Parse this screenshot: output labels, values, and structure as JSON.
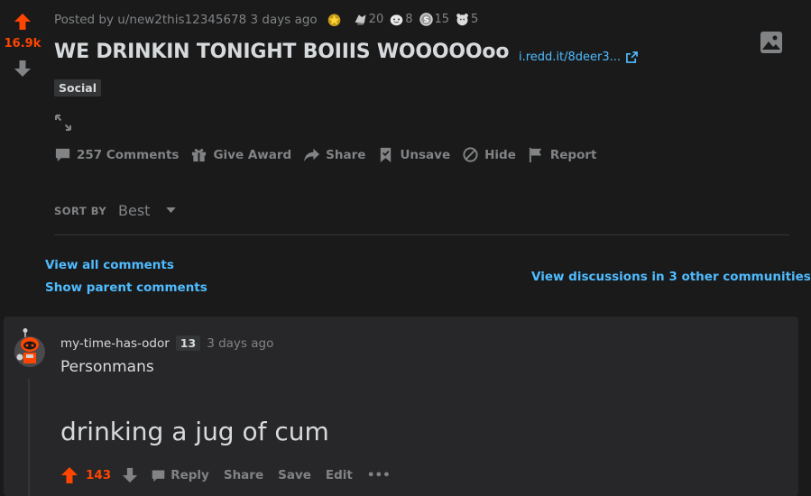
{
  "post": {
    "score": "16.9k",
    "meta_prefix": "Posted by",
    "author": "u/new2this12345678",
    "time": "3 days ago",
    "awards": [
      {
        "icon": "gold-award-icon",
        "count": ""
      },
      {
        "icon": "helpful-award-icon",
        "count": "20"
      },
      {
        "icon": "wholesome-award-icon",
        "count": "8"
      },
      {
        "icon": "silver-coin-award-icon",
        "count": "15"
      },
      {
        "icon": "bear-award-icon",
        "count": "5"
      }
    ],
    "title": "WE DRINKIN TONIGHT BOIIIS WOOOOOoo",
    "domain": "i.redd.it/8deer3...",
    "flair": "Social",
    "actions": {
      "comments": "257 Comments",
      "award": "Give Award",
      "share": "Share",
      "unsave": "Unsave",
      "hide": "Hide",
      "report": "Report"
    }
  },
  "sort": {
    "label": "SORT BY",
    "value": "Best"
  },
  "links": {
    "view_all": "View all comments",
    "show_parent": "Show parent comments",
    "other_discussions": "View discussions in 3 other communities"
  },
  "comment": {
    "author": "my-time-has-odor",
    "flair": "13",
    "time": "3 days ago",
    "line1": "Personmans",
    "line2": "drinking a jug of cum",
    "score": "143",
    "actions": {
      "reply": "Reply",
      "share": "Share",
      "save": "Save",
      "edit": "Edit",
      "more": "•••"
    }
  },
  "colors": {
    "upvote": "#ff4500",
    "link": "#4fbcff",
    "background": "#1a1a1b",
    "card": "#272729"
  }
}
